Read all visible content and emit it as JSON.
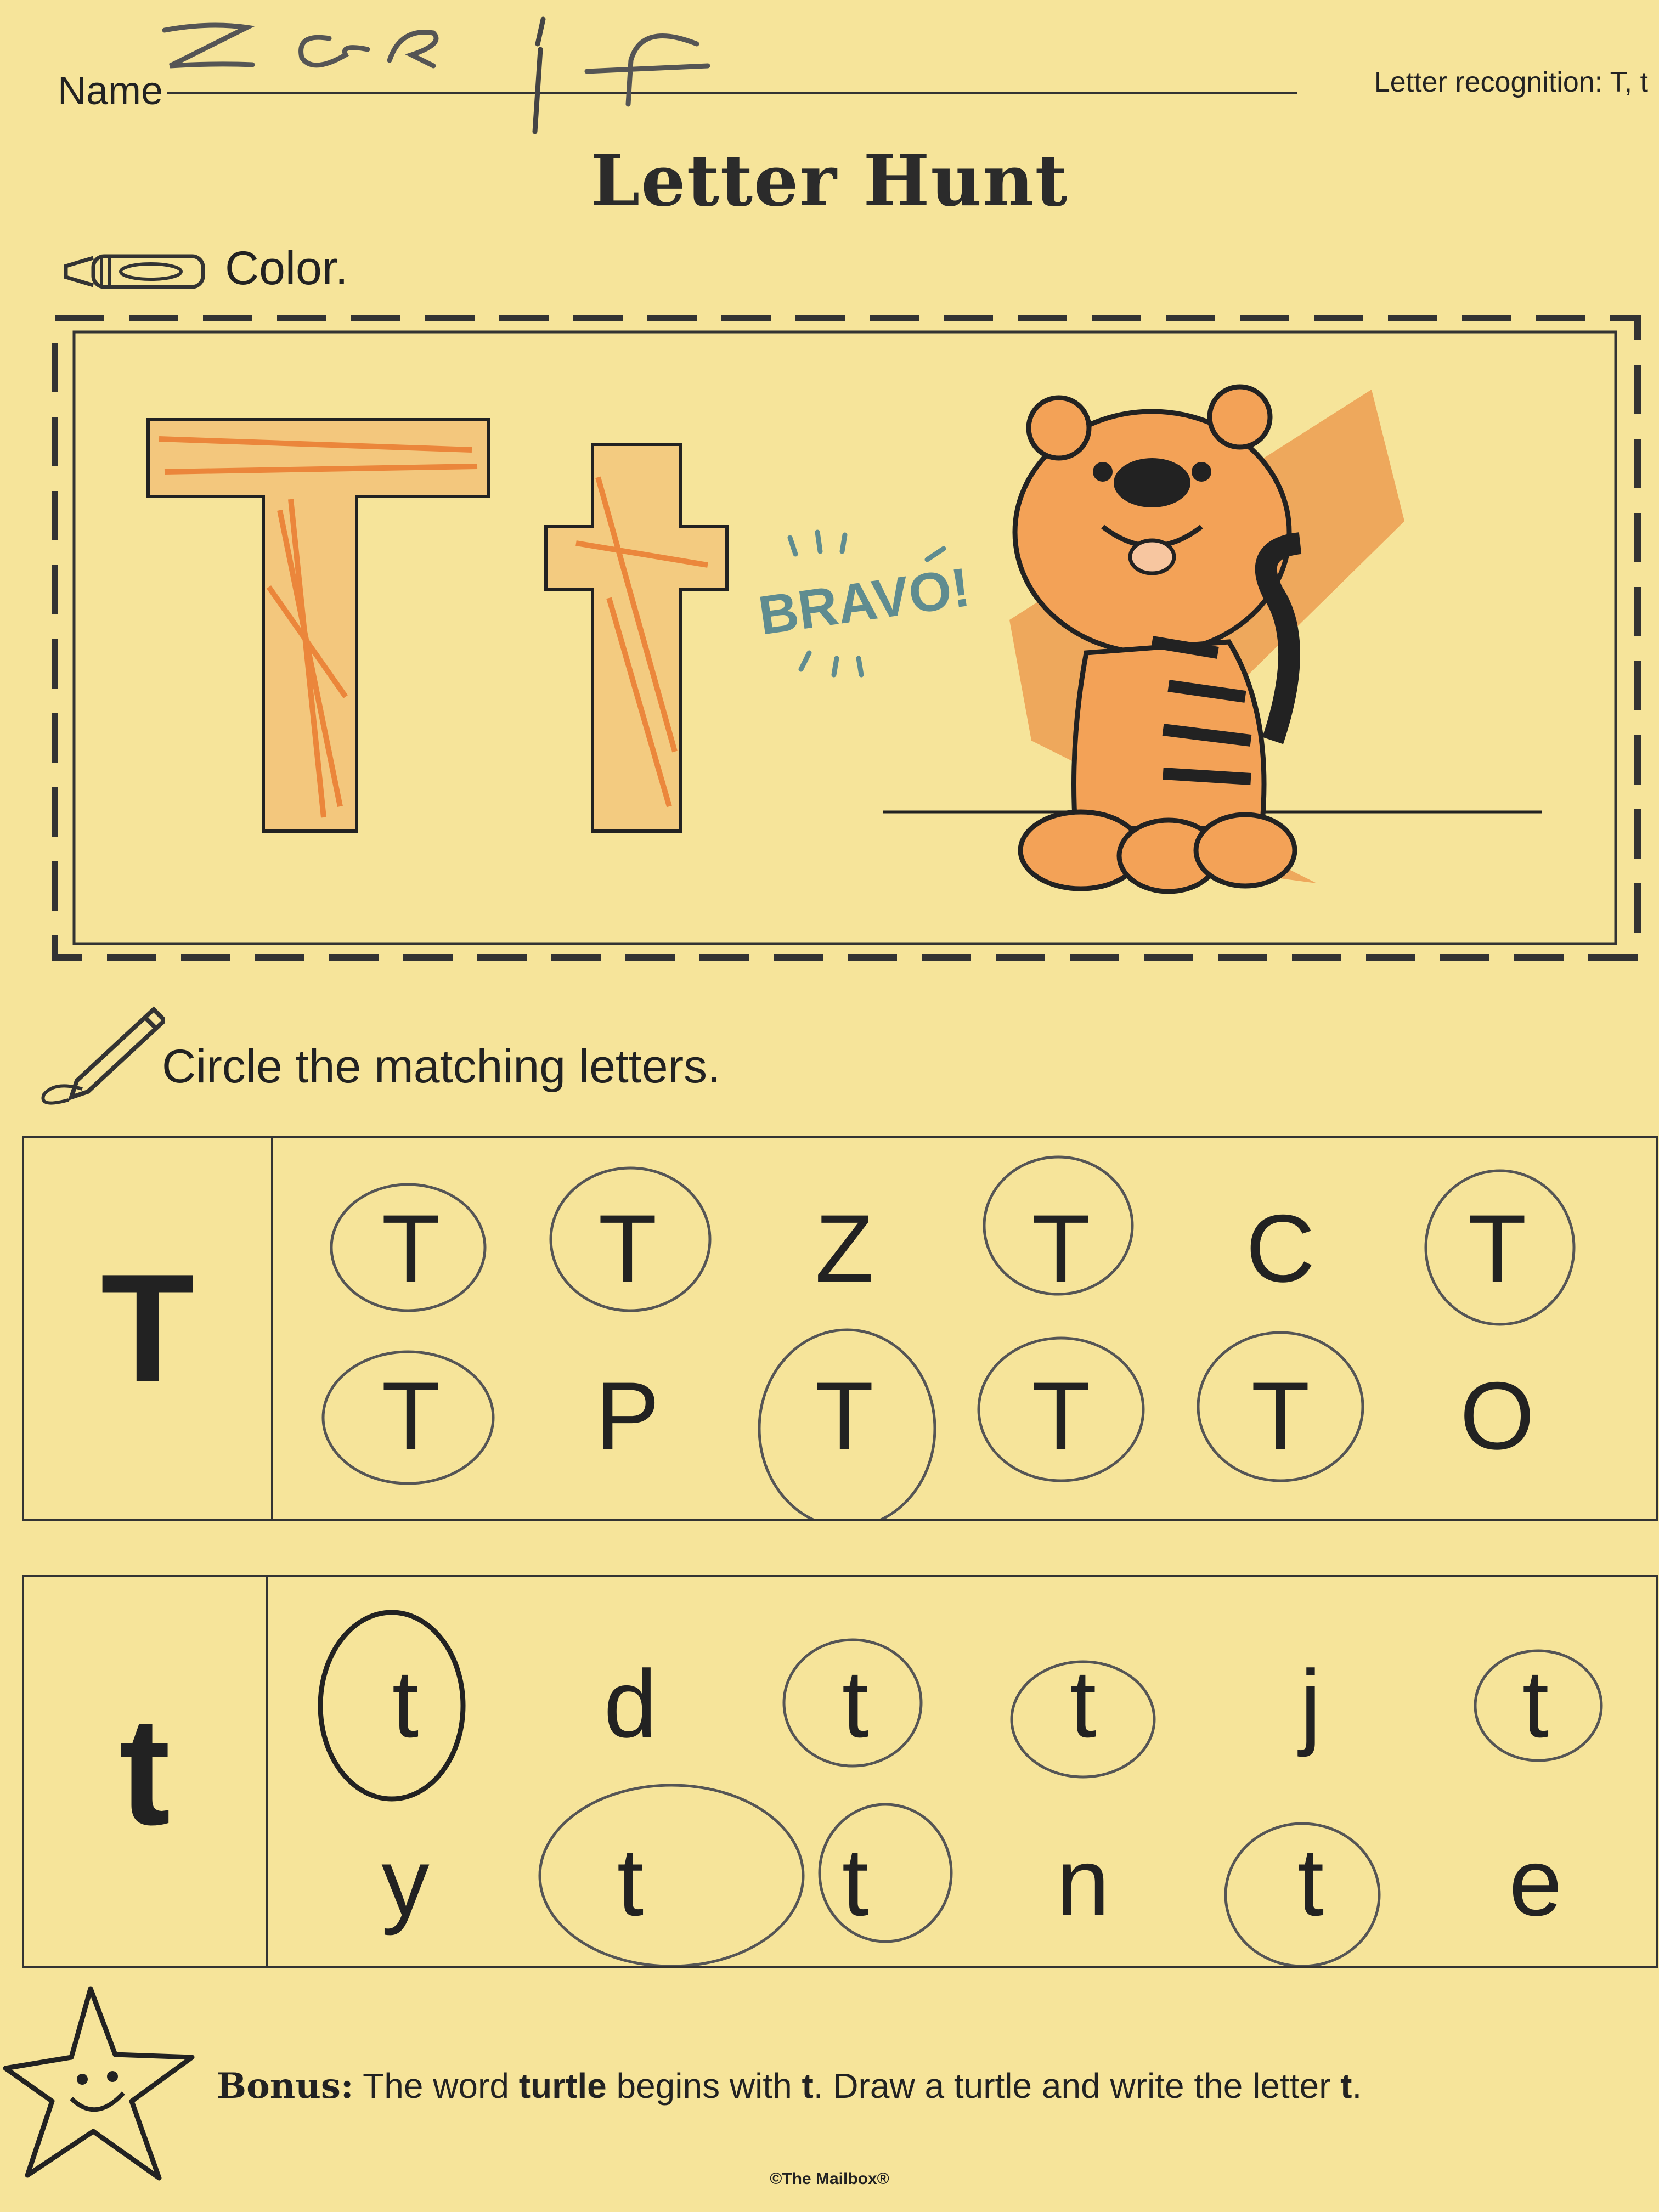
{
  "header": {
    "name_label": "Name",
    "name_written": "Zayif",
    "topic": "Letter recognition: T, t"
  },
  "title": "Letter Hunt",
  "color_section": {
    "instruction": "Color.",
    "uppercase": "T",
    "lowercase": "t",
    "stamp": "BRAVO!",
    "icon": "crayon-icon"
  },
  "match_section": {
    "instruction": "Circle the matching letters.",
    "icon": "pencil-icon",
    "upper_grid": {
      "key": "T",
      "rows": [
        [
          "T",
          "T",
          "Z",
          "T",
          "C",
          "T"
        ],
        [
          "T",
          "P",
          "T",
          "T",
          "T",
          "O"
        ]
      ]
    },
    "lower_grid": {
      "key": "t",
      "rows": [
        [
          "t",
          "d",
          "t",
          "t",
          "j",
          "t"
        ],
        [
          "y",
          "t",
          "t",
          "n",
          "t",
          "e"
        ]
      ]
    }
  },
  "bonus": {
    "label": "Bonus:",
    "text_1": " The word ",
    "word": "turtle",
    "text_2": " begins with ",
    "letter": "t",
    "text_3": ". Draw a turtle and write the letter ",
    "letter_2": "t",
    "text_4": "."
  },
  "copyright": "©The Mailbox®",
  "colors": {
    "paper": "#f6e49a",
    "crayon_orange": "#e8762a",
    "ink": "#222222",
    "pencil": "#555555",
    "stamp": "#5f8c90"
  }
}
